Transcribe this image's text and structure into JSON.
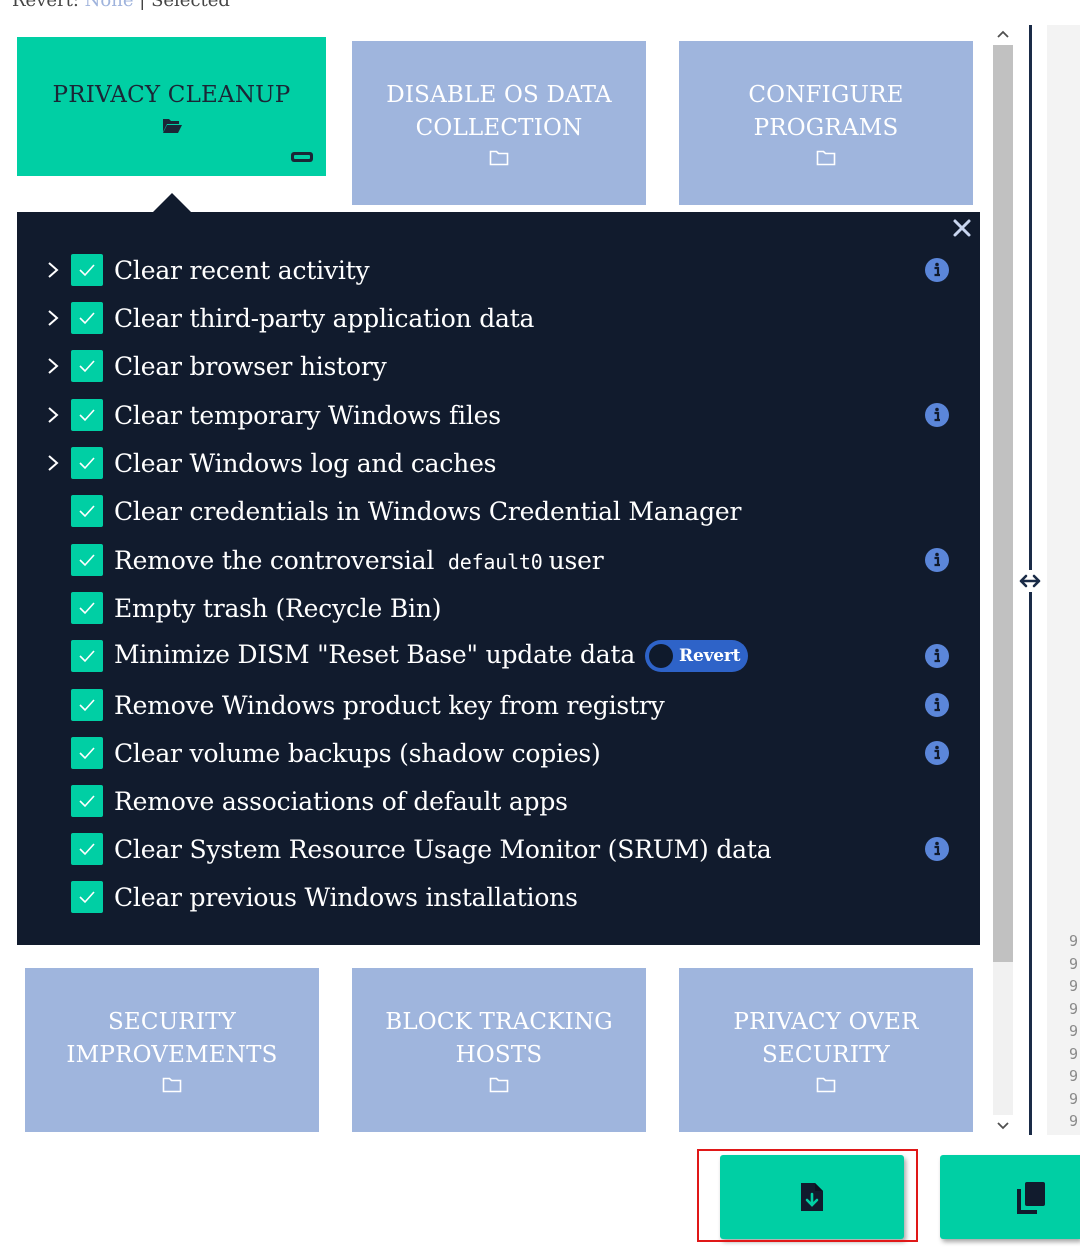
{
  "status": {
    "revert_label": "Revert:",
    "revert_value": "None",
    "separator": "|",
    "selected_label": "Selected"
  },
  "cards_top": [
    {
      "line1": "PRIVACY CLEANUP",
      "line2": "",
      "state": "active"
    },
    {
      "line1": "DISABLE OS DATA",
      "line2": "COLLECTION",
      "state": "inactive"
    },
    {
      "line1": "CONFIGURE",
      "line2": "PROGRAMS",
      "state": "inactive"
    }
  ],
  "cards_bottom": [
    {
      "line1": "SECURITY",
      "line2": "IMPROVEMENTS"
    },
    {
      "line1": "BLOCK TRACKING",
      "line2": "HOSTS"
    },
    {
      "line1": "PRIVACY OVER",
      "line2": "SECURITY"
    }
  ],
  "items": [
    {
      "label": "Clear recent activity",
      "expandable": true,
      "checked": true,
      "info": true
    },
    {
      "label": "Clear third-party application data",
      "expandable": true,
      "checked": true,
      "info": false
    },
    {
      "label": "Clear browser history",
      "expandable": true,
      "checked": true,
      "info": false
    },
    {
      "label": "Clear temporary Windows files",
      "expandable": true,
      "checked": true,
      "info": true
    },
    {
      "label": "Clear Windows log and caches",
      "expandable": true,
      "checked": true,
      "info": false
    },
    {
      "label": "Clear credentials in Windows Credential Manager",
      "expandable": false,
      "checked": true,
      "info": false
    },
    {
      "label_pre": "Remove the controversial",
      "label_code": "default0",
      "label_post": "user",
      "expandable": false,
      "checked": true,
      "info": true
    },
    {
      "label": "Empty trash (Recycle Bin)",
      "expandable": false,
      "checked": true,
      "info": false
    },
    {
      "label": "Minimize DISM \"Reset Base\" update data",
      "revert_label": "Revert",
      "expandable": false,
      "checked": true,
      "info": true
    },
    {
      "label": "Remove Windows product key from registry",
      "expandable": false,
      "checked": true,
      "info": true
    },
    {
      "label": "Clear volume backups (shadow copies)",
      "expandable": false,
      "checked": true,
      "info": true
    },
    {
      "label": "Remove associations of default apps",
      "expandable": false,
      "checked": true,
      "info": false
    },
    {
      "label": "Clear System Resource Usage Monitor (SRUM) data",
      "expandable": false,
      "checked": true,
      "info": true
    },
    {
      "label": "Clear previous Windows installations",
      "expandable": false,
      "checked": true,
      "info": false
    }
  ],
  "right_pane_digits": [
    "9",
    "9",
    "9",
    "9",
    "9",
    "9",
    "9",
    "9",
    "9"
  ],
  "actions": {
    "save_icon": "file-download-icon",
    "copy_icon": "copy-icon"
  },
  "colors": {
    "accent": "#00cfa4",
    "card_inactive": "#9fb5dd",
    "panel_bg": "#111b2d",
    "revert_badge": "#2e63c8",
    "highlight": "#e01818"
  }
}
